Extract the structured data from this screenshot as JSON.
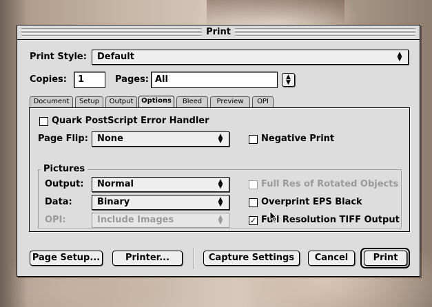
{
  "window": {
    "title": "Print"
  },
  "print_style": {
    "label": "Print Style:",
    "value": "Default"
  },
  "copies": {
    "label": "Copies:",
    "value": "1"
  },
  "pages": {
    "label": "Pages:",
    "value": "All"
  },
  "tabs": [
    {
      "label": "Document",
      "active": false
    },
    {
      "label": "Setup",
      "active": false
    },
    {
      "label": "Output",
      "active": false
    },
    {
      "label": "Options",
      "active": true
    },
    {
      "label": "Bleed",
      "active": false
    },
    {
      "label": "Preview",
      "active": false
    },
    {
      "label": "OPI",
      "active": false
    }
  ],
  "options": {
    "error_handler": {
      "label": "Quark PostScript Error Handler",
      "checked": false
    },
    "page_flip": {
      "label": "Page Flip:",
      "value": "None"
    },
    "negative_print": {
      "label": "Negative Print",
      "checked": false
    }
  },
  "pictures": {
    "title": "Pictures",
    "output": {
      "label": "Output:",
      "value": "Normal"
    },
    "data": {
      "label": "Data:",
      "value": "Binary"
    },
    "opi": {
      "label": "OPI:",
      "value": "Include Images",
      "enabled": false
    },
    "full_res_rotated": {
      "label": "Full Res of Rotated Objects",
      "checked": false,
      "enabled": false
    },
    "overprint_eps": {
      "label": "Overprint EPS Black",
      "checked": false
    },
    "full_res_tiff": {
      "label": "Full Resolution TIFF Output",
      "checked": true
    }
  },
  "buttons": {
    "page_setup": "Page Setup...",
    "printer": "Printer...",
    "capture_settings": "Capture Settings",
    "cancel": "Cancel",
    "print": "Print"
  },
  "colors": {
    "dialog_bg": "#dddddd",
    "disabled_text": "#9a9a9a"
  }
}
